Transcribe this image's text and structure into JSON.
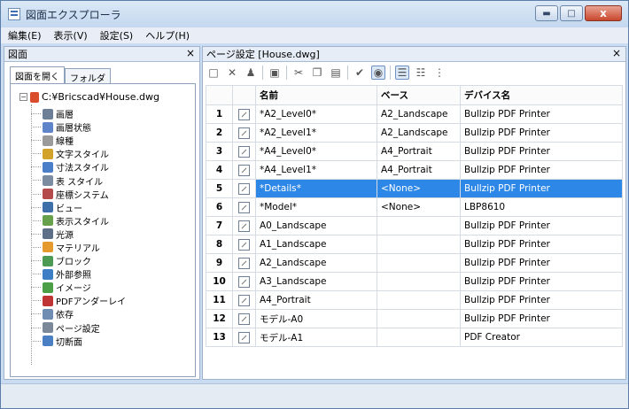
{
  "window": {
    "title": "図面エクスプローラ"
  },
  "menu": [
    "編集(E)",
    "表示(V)",
    "設定(S)",
    "ヘルプ(H)"
  ],
  "left_panel": {
    "title": "図面",
    "close": "×",
    "tabs": [
      "図面を開く",
      "フォルダ"
    ],
    "root": "C:¥Bricscad¥House.dwg",
    "items": [
      {
        "label": "画層",
        "icon": "layer-icon",
        "color": "#6d7f97"
      },
      {
        "label": "画層状態",
        "icon": "layer-state-icon",
        "color": "#5f84c9"
      },
      {
        "label": "線種",
        "icon": "linetype-icon",
        "color": "#9a9a9a"
      },
      {
        "label": "文字スタイル",
        "icon": "text-style-icon",
        "color": "#d2a22b"
      },
      {
        "label": "寸法スタイル",
        "icon": "dimension-style-icon",
        "color": "#4b7ec8"
      },
      {
        "label": "表 スタイル",
        "icon": "table-style-icon",
        "color": "#7c8ca0"
      },
      {
        "label": "座標システム",
        "icon": "ucs-icon",
        "color": "#b54a4a"
      },
      {
        "label": "ビュー",
        "icon": "view-icon",
        "color": "#3f6fa8"
      },
      {
        "label": "表示スタイル",
        "icon": "visual-style-icon",
        "color": "#67a14b"
      },
      {
        "label": "光源",
        "icon": "light-icon",
        "color": "#5c6f86"
      },
      {
        "label": "マテリアル",
        "icon": "material-icon",
        "color": "#e59a2e"
      },
      {
        "label": "ブロック",
        "icon": "block-icon",
        "color": "#4d9a55"
      },
      {
        "label": "外部参照",
        "icon": "xref-icon",
        "color": "#3d7ec5"
      },
      {
        "label": "イメージ",
        "icon": "image-icon",
        "color": "#4c9f47"
      },
      {
        "label": "PDFアンダーレイ",
        "icon": "pdf-underlay-icon",
        "color": "#bf3434"
      },
      {
        "label": "依存",
        "icon": "dependency-icon",
        "color": "#6f8cb3"
      },
      {
        "label": "ページ設定",
        "icon": "page-setup-icon",
        "color": "#7b8899"
      },
      {
        "label": "切断面",
        "icon": "section-icon",
        "color": "#4b7fc4"
      }
    ]
  },
  "right_panel": {
    "title": "ページ設定 [House.dwg]",
    "close": "×",
    "columns": [
      "名前",
      "ベース",
      "デバイス名"
    ],
    "rows": [
      {
        "num": "1",
        "name": "*A2_Level0*",
        "base": "A2_Landscape",
        "device": "Bullzip PDF Printer"
      },
      {
        "num": "2",
        "name": "*A2_Level1*",
        "base": "A2_Landscape",
        "device": "Bullzip PDF Printer"
      },
      {
        "num": "3",
        "name": "*A4_Level0*",
        "base": "A4_Portrait",
        "device": "Bullzip PDF Printer"
      },
      {
        "num": "4",
        "name": "*A4_Level1*",
        "base": "A4_Portrait",
        "device": "Bullzip PDF Printer"
      },
      {
        "num": "5",
        "name": "*Details*",
        "base": "<None>",
        "device": "Bullzip PDF Printer"
      },
      {
        "num": "6",
        "name": "*Model*",
        "base": "<None>",
        "device": "LBP8610"
      },
      {
        "num": "7",
        "name": "A0_Landscape",
        "base": "",
        "device": "Bullzip PDF Printer"
      },
      {
        "num": "8",
        "name": "A1_Landscape",
        "base": "",
        "device": "Bullzip PDF Printer"
      },
      {
        "num": "9",
        "name": "A2_Landscape",
        "base": "",
        "device": "Bullzip PDF Printer"
      },
      {
        "num": "10",
        "name": "A3_Landscape",
        "base": "",
        "device": "Bullzip PDF Printer"
      },
      {
        "num": "11",
        "name": "A4_Portrait",
        "base": "",
        "device": "Bullzip PDF Printer"
      },
      {
        "num": "12",
        "name": "モデル-A0",
        "base": "",
        "device": "Bullzip PDF Printer"
      },
      {
        "num": "13",
        "name": "モデル-A1",
        "base": "",
        "device": "PDF Creator"
      }
    ],
    "selected_row": "5"
  }
}
